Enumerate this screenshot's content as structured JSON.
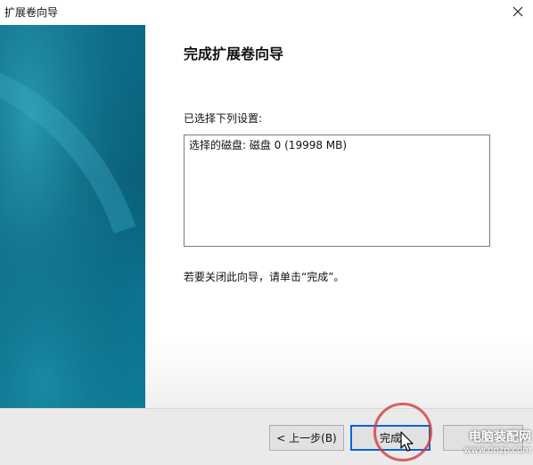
{
  "window": {
    "title": "扩展卷向导",
    "close_icon": "close-icon"
  },
  "main": {
    "heading": "完成扩展卷向导",
    "settings_label": "已选择下列设置:",
    "settings_text": "选择的磁盘: 磁盘 0 (19998 MB)",
    "hint": "若要关闭此向导，请单击“完成”。"
  },
  "footer": {
    "back_label": "< 上一步(B)",
    "finish_label": "完成",
    "cancel_label": ""
  },
  "watermark": {
    "top": "电脑装配网",
    "bottom": "www.dnzp.com"
  },
  "colors": {
    "side_panel": "#0d6b88",
    "accent_border": "#0a64d6",
    "highlight": "#d23c3c"
  }
}
